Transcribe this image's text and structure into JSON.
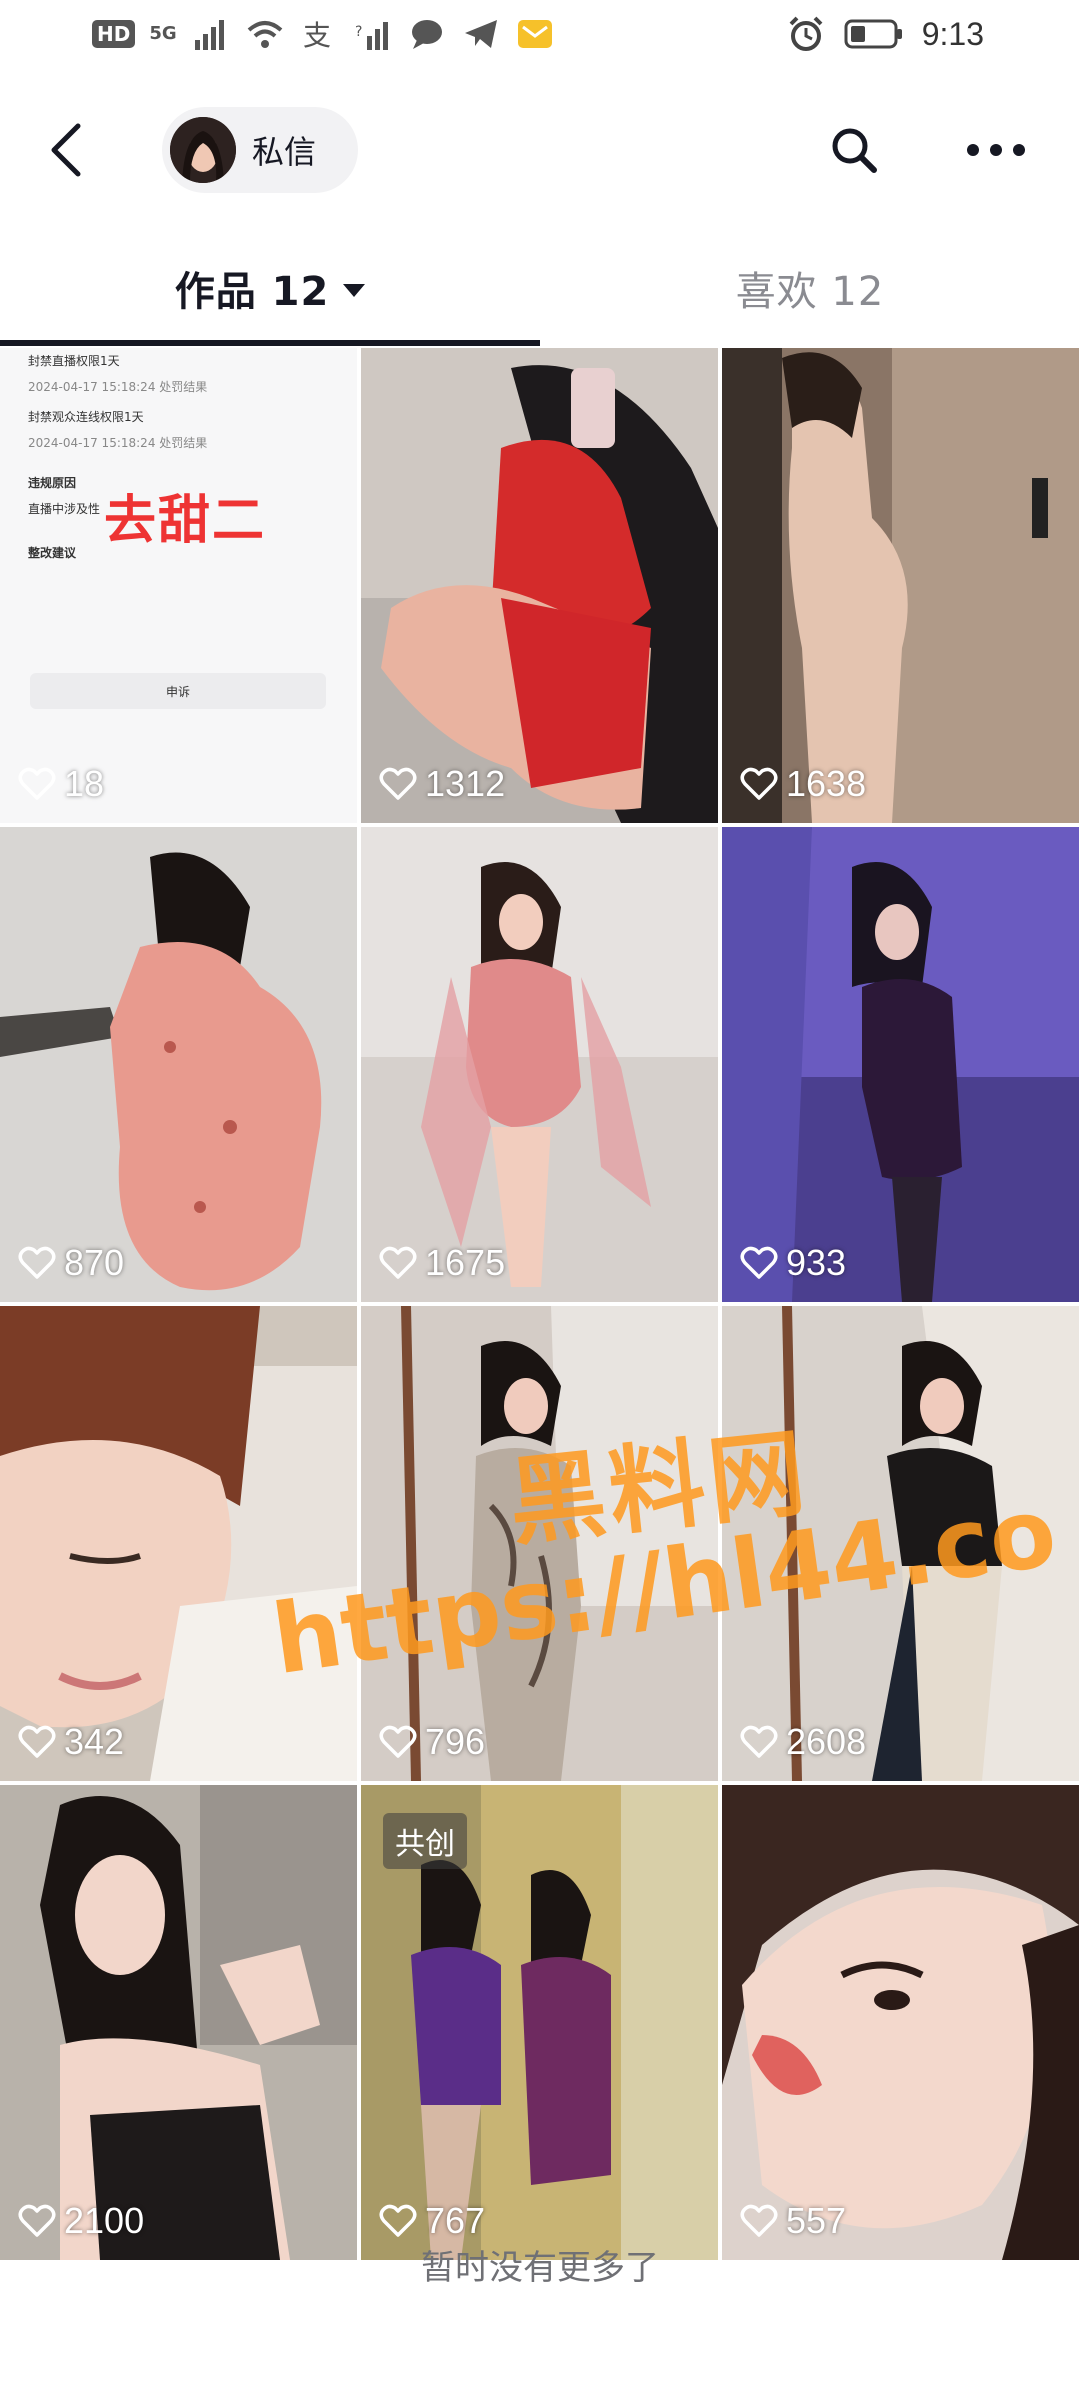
{
  "status_bar": {
    "hd": "HD",
    "network": "5G",
    "time": "9:13",
    "icons": [
      "signal-icon",
      "wifi-icon",
      "alipay-icon",
      "signal2-icon",
      "chat-icon",
      "telegram-icon",
      "mail-icon",
      "alarm-icon",
      "battery-icon"
    ]
  },
  "header": {
    "dm_label": "私信",
    "icons": {
      "back": "back-arrow-icon",
      "search": "search-icon",
      "more": "more-dots-icon"
    }
  },
  "tabs": {
    "works": "作品 12",
    "likes": "喜欢 12"
  },
  "tile_screenshot": {
    "lines": [
      "封禁直播权限1天",
      "2024-04-17 15:18:24 处罚结果",
      "封禁观众连线权限1天",
      "2024-04-17 15:18:24 处罚结果",
      "违规原因",
      "直播中涉及性",
      "整改建议"
    ],
    "stamp": "去甜二",
    "button": "申诉"
  },
  "grid": {
    "tiles": [
      {
        "likes": "18",
        "badge": ""
      },
      {
        "likes": "1312",
        "badge": ""
      },
      {
        "likes": "1638",
        "badge": ""
      },
      {
        "likes": "870",
        "badge": ""
      },
      {
        "likes": "1675",
        "badge": ""
      },
      {
        "likes": "933",
        "badge": ""
      },
      {
        "likes": "342",
        "badge": ""
      },
      {
        "likes": "796",
        "badge": ""
      },
      {
        "likes": "2608",
        "badge": ""
      },
      {
        "likes": "2100",
        "badge": ""
      },
      {
        "likes": "767",
        "badge": "共创"
      },
      {
        "likes": "557",
        "badge": ""
      }
    ]
  },
  "watermark": {
    "line1": "黑料网",
    "line2": "https://hl44.co"
  },
  "footer": "暂时没有更多了"
}
